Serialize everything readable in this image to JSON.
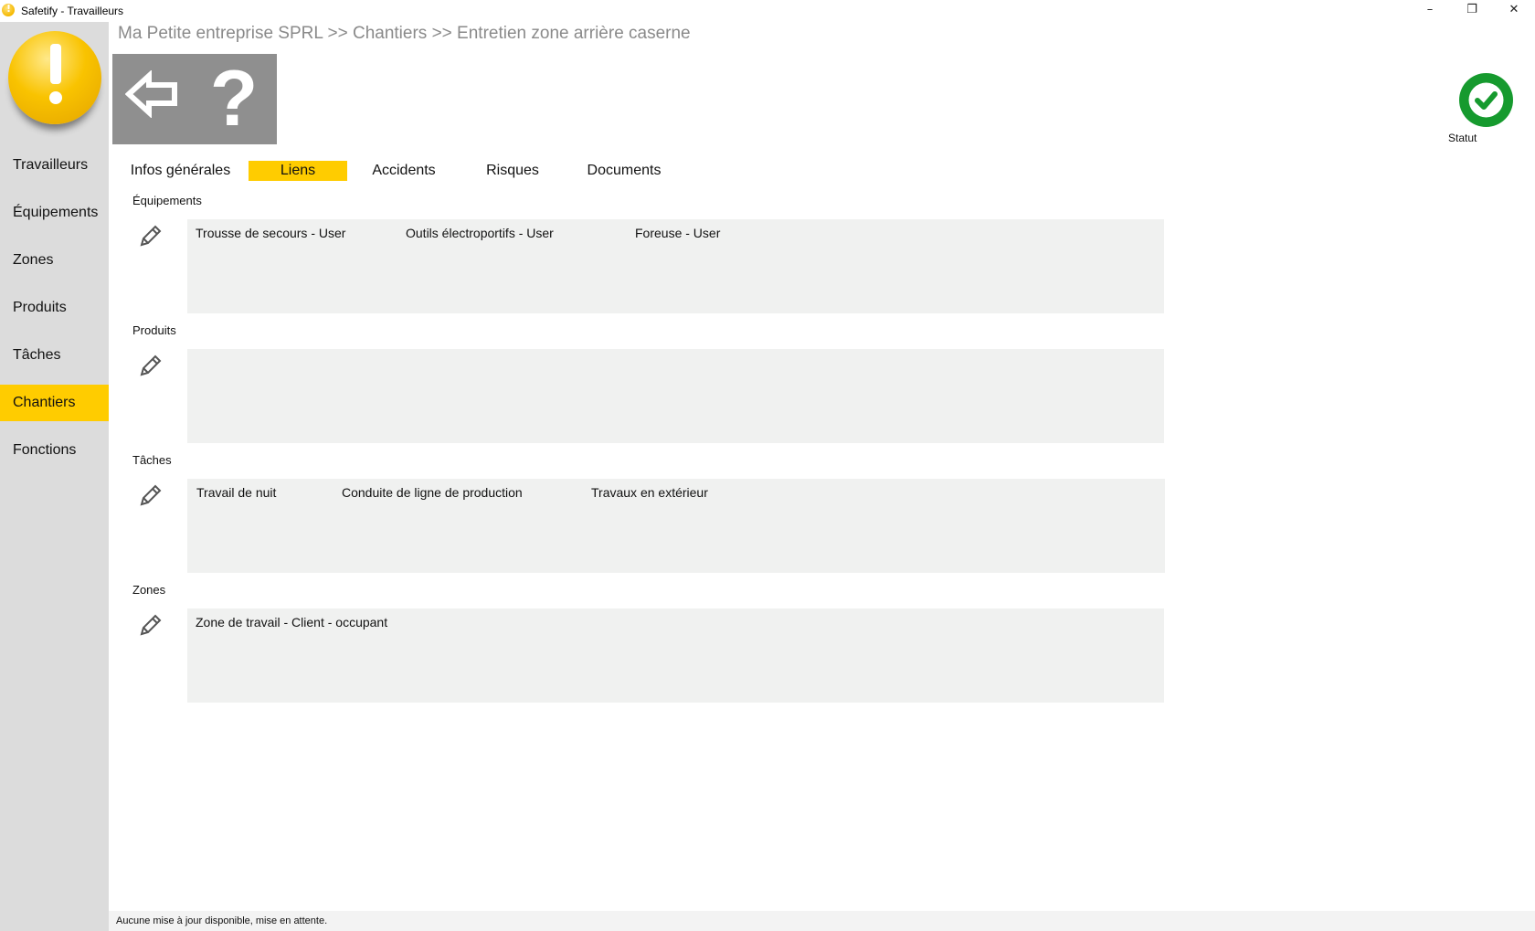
{
  "window": {
    "title": "Safetify - Travailleurs",
    "minimize": "–",
    "maximize": "❐",
    "close": "✕"
  },
  "breadcrumb": "Ma Petite entreprise SPRL >> Chantiers >> Entretien zone arrière caserne",
  "toolbar": {
    "help_label": "?"
  },
  "status": {
    "label": "Statut",
    "color": "#169a2e"
  },
  "sidebar": {
    "items": [
      {
        "label": "Travailleurs"
      },
      {
        "label": "Équipements"
      },
      {
        "label": "Zones"
      },
      {
        "label": "Produits"
      },
      {
        "label": "Tâches"
      },
      {
        "label": "Chantiers",
        "active": true
      },
      {
        "label": "Fonctions"
      }
    ]
  },
  "tabs": [
    {
      "label": "Infos générales"
    },
    {
      "label": "Liens",
      "active": true
    },
    {
      "label": "Accidents"
    },
    {
      "label": "Risques"
    },
    {
      "label": "Documents"
    }
  ],
  "sections": {
    "equipements": {
      "title": "Équipements",
      "items": [
        "Trousse de secours - User",
        "Outils électroportifs - User",
        "Foreuse - User"
      ]
    },
    "produits": {
      "title": "Produits",
      "items": []
    },
    "taches": {
      "title": "Tâches",
      "items": [
        "Travail de nuit",
        "Conduite de ligne de production",
        "Travaux en extérieur"
      ]
    },
    "zones": {
      "title": "Zones",
      "items": [
        "Zone de travail - Client - occupant"
      ]
    }
  },
  "statusbar": {
    "text": "Aucune mise à jour disponible, mise en attente."
  },
  "colors": {
    "accent": "#ffcc00",
    "sidebar_bg": "#dcdcdc",
    "panel_bg": "#f0f1f0"
  }
}
